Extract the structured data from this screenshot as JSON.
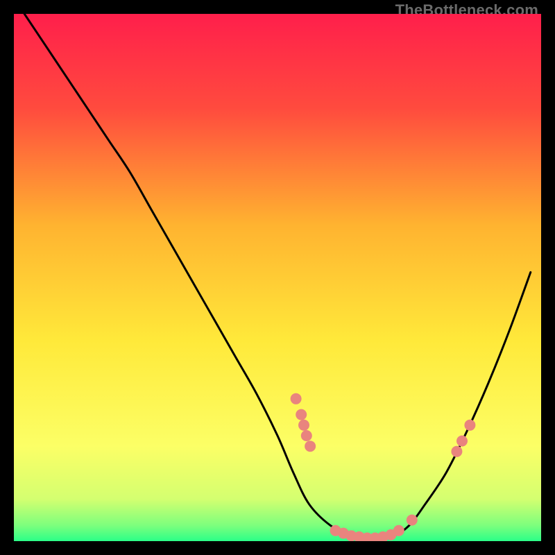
{
  "watermark": "TheBottleneck.com",
  "chart_data": {
    "type": "line",
    "title": "",
    "xlabel": "",
    "ylabel": "",
    "xlim": [
      0,
      100
    ],
    "ylim": [
      0,
      100
    ],
    "gradient_stops": [
      {
        "offset": 0,
        "color": "#ff1f4b"
      },
      {
        "offset": 18,
        "color": "#ff4b3e"
      },
      {
        "offset": 40,
        "color": "#ffb330"
      },
      {
        "offset": 62,
        "color": "#ffe93a"
      },
      {
        "offset": 82,
        "color": "#fcff66"
      },
      {
        "offset": 92,
        "color": "#d4ff70"
      },
      {
        "offset": 97,
        "color": "#7dff7d"
      },
      {
        "offset": 100,
        "color": "#2bff88"
      }
    ],
    "series": [
      {
        "name": "bottleneck-curve",
        "x": [
          2,
          6,
          10,
          14,
          18,
          22,
          26,
          30,
          34,
          38,
          42,
          46,
          50,
          53,
          56,
          60,
          64,
          68,
          72,
          75,
          78,
          82,
          86,
          90,
          94,
          98
        ],
        "y": [
          100,
          94,
          88,
          82,
          76,
          70,
          63,
          56,
          49,
          42,
          35,
          28,
          20,
          13,
          7,
          3,
          1,
          0,
          1,
          3,
          7,
          13,
          21,
          30,
          40,
          51
        ]
      }
    ],
    "markers": [
      {
        "x": 53.5,
        "y": 27
      },
      {
        "x": 54.5,
        "y": 24
      },
      {
        "x": 55.0,
        "y": 22
      },
      {
        "x": 55.5,
        "y": 20
      },
      {
        "x": 56.2,
        "y": 18
      },
      {
        "x": 61.0,
        "y": 2
      },
      {
        "x": 62.5,
        "y": 1.5
      },
      {
        "x": 64.0,
        "y": 1
      },
      {
        "x": 65.5,
        "y": 0.8
      },
      {
        "x": 67.0,
        "y": 0.6
      },
      {
        "x": 68.5,
        "y": 0.6
      },
      {
        "x": 70.0,
        "y": 0.8
      },
      {
        "x": 71.5,
        "y": 1.2
      },
      {
        "x": 73.0,
        "y": 2
      },
      {
        "x": 75.5,
        "y": 4
      },
      {
        "x": 84.0,
        "y": 17
      },
      {
        "x": 85.0,
        "y": 19
      },
      {
        "x": 86.5,
        "y": 22
      }
    ],
    "marker_style": {
      "fill": "#e9847e",
      "r": 8
    },
    "curve_style": {
      "stroke": "#000000",
      "width": 3
    }
  }
}
